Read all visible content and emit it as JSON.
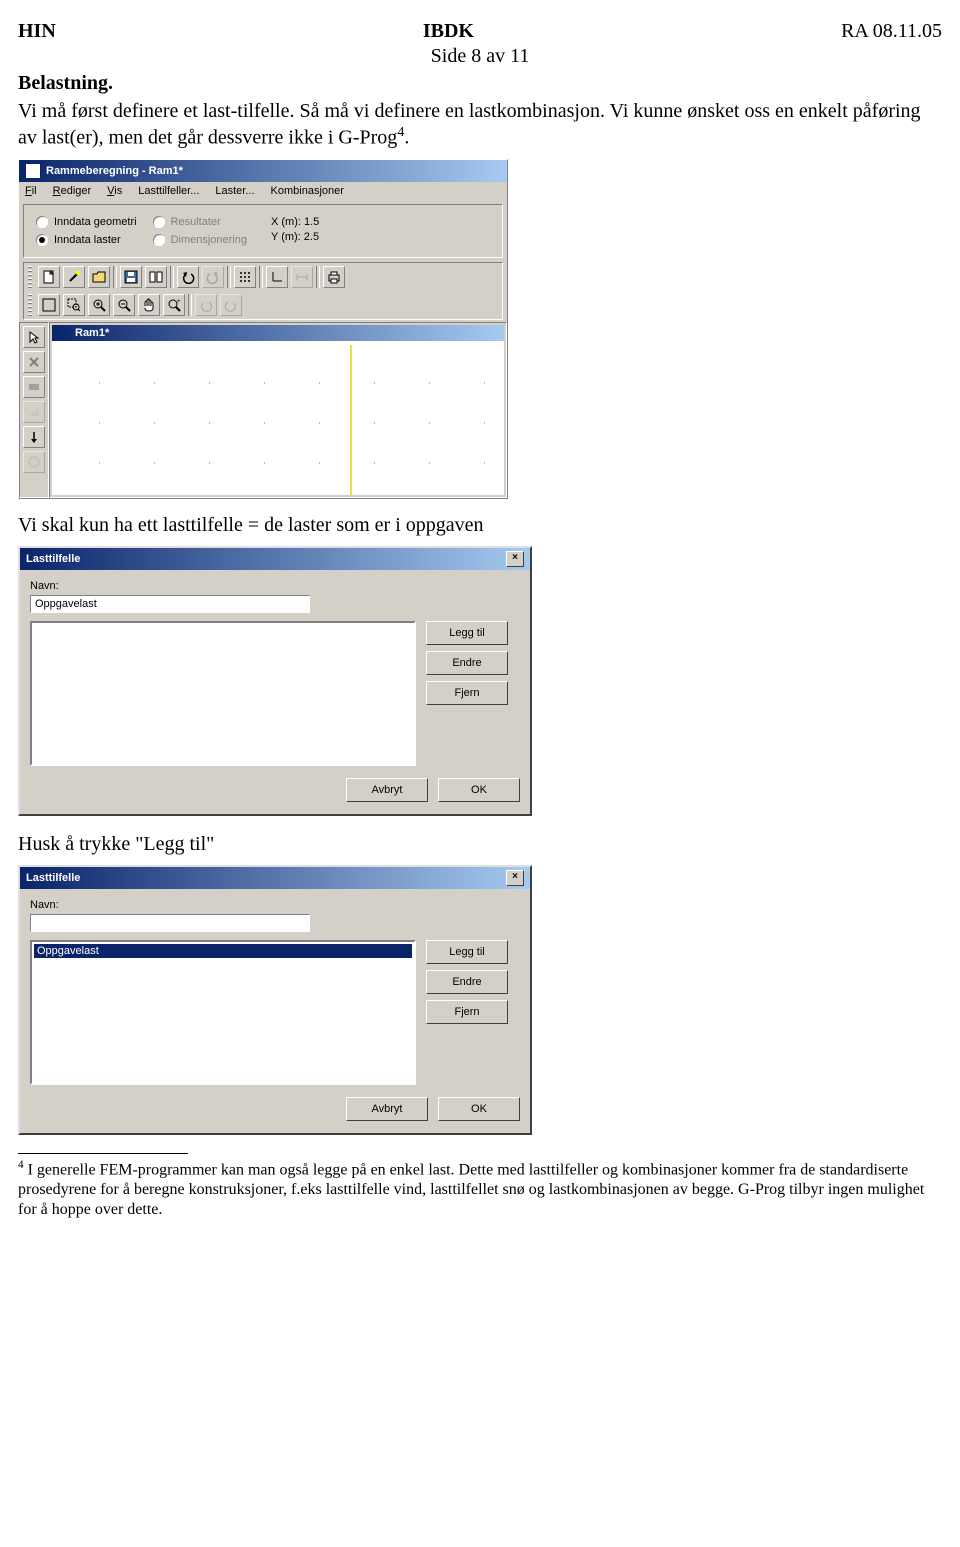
{
  "header": {
    "left": "HIN",
    "center": "IBDK",
    "right": "RA 08.11.05",
    "pageno": "Side 8 av 11"
  },
  "body": {
    "h1": "Belastning.",
    "p1a": "Vi må først definere et last-tilfelle. Så må vi definere en lastkombinasjon. Vi kunne ønsket oss en enkelt påføring av last(er), men det går dessverre ikke i G-Prog",
    "p1sup": "4",
    "p1dot": ".",
    "p2": "Vi skal kun ha ett lasttilfelle = de laster som er i oppgaven",
    "p3": "Husk å trykke \"Legg til\""
  },
  "app1": {
    "title": "Rammeberegning - Ram1*",
    "menu": [
      "Fil",
      "Rediger",
      "Vis",
      "Lasttilfeller...",
      "Laster...",
      "Kombinasjoner"
    ],
    "radios": {
      "inndata_geometri": "Inndata geometri",
      "inndata_laster": "Inndata laster",
      "resultater": "Resultater",
      "dimensjonering": "Dimensjonering"
    },
    "coords": {
      "x": "X (m): 1.5",
      "y": "Y (m): 2.5"
    },
    "doc_title": "Ram1*"
  },
  "dialog1": {
    "title": "Lasttilfelle",
    "name_label": "Navn:",
    "name_value": "Oppgavelast",
    "list_items": [],
    "buttons": {
      "add": "Legg til",
      "edit": "Endre",
      "remove": "Fjern",
      "cancel": "Avbryt",
      "ok": "OK"
    }
  },
  "dialog2": {
    "title": "Lasttilfelle",
    "name_label": "Navn:",
    "name_value": "",
    "list_items": [
      "Oppgavelast"
    ],
    "buttons": {
      "add": "Legg til",
      "edit": "Endre",
      "remove": "Fjern",
      "cancel": "Avbryt",
      "ok": "OK"
    }
  },
  "footnote": {
    "marker": "4",
    "text": " I generelle FEM-programmer kan man også legge på en enkel last. Dette med lasttilfeller og kombinasjoner kommer fra de standardiserte prosedyrene for å beregne konstruksjoner, f.eks lasttilfelle vind, lasttilfellet snø og lastkombinasjonen av begge. G-Prog tilbyr ingen mulighet for å hoppe over dette."
  }
}
